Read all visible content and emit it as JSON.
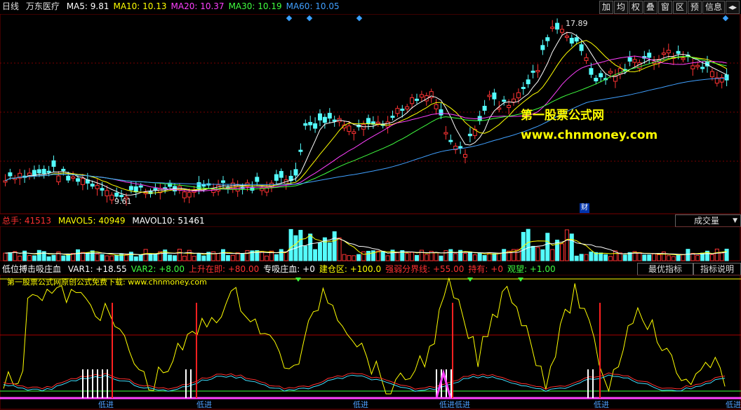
{
  "top": {
    "period": "日线",
    "stock": "万东医疗",
    "ma": [
      {
        "label": "MA5:",
        "value": "9.81",
        "color": "#ffffff"
      },
      {
        "label": "MA10:",
        "value": "10.13",
        "color": "#ffff00"
      },
      {
        "label": "MA20:",
        "value": "10.37",
        "color": "#ff40ff"
      },
      {
        "label": "MA30:",
        "value": "10.19",
        "color": "#40ff40"
      },
      {
        "label": "MA60:",
        "value": "10.05",
        "color": "#40a0ff"
      }
    ],
    "toolbar": [
      "加",
      "均",
      "权",
      "叠",
      "窗",
      "区",
      "预",
      "信息"
    ]
  },
  "price": {
    "high_label": "17.89",
    "low_label": "9.61",
    "fin_marker": "财",
    "watermark_cn": "第一股票公式网",
    "watermark_url": "www.chnmoney.com"
  },
  "volume": {
    "total_label": "总手:",
    "total_value": "41513",
    "mavol5_label": "MAVOL5:",
    "mavol5_value": "40949",
    "mavol10_label": "MAVOL10:",
    "mavol10_value": "51461",
    "select_label": "成交量"
  },
  "indicator": {
    "name": "低位搏击吸庄血",
    "items": [
      {
        "text": "VAR1: +18.55",
        "color": "#ffffff"
      },
      {
        "text": "VAR2: +8.00",
        "color": "#40ff40"
      },
      {
        "text": "上升在即: +80.00",
        "color": "#ff3030"
      },
      {
        "text": "专吸庄血: +0",
        "color": "#ffffff"
      },
      {
        "text": "建仓区: +100.0",
        "color": "#ffff00"
      },
      {
        "text": "强弱分界线: +55.00",
        "color": "#ff3030"
      },
      {
        "text": "持有: +0",
        "color": "#ff3030"
      },
      {
        "text": "观望: +1.00",
        "color": "#40ff40"
      }
    ],
    "btn_best": "最优指标",
    "btn_help": "指标说明",
    "watermark": "第一股票公式网原创公式免费下载: www.chnmoney.com",
    "buy_labels": [
      "低进",
      "低进",
      "低进",
      "低进低进",
      "低进",
      "低进"
    ]
  }
}
